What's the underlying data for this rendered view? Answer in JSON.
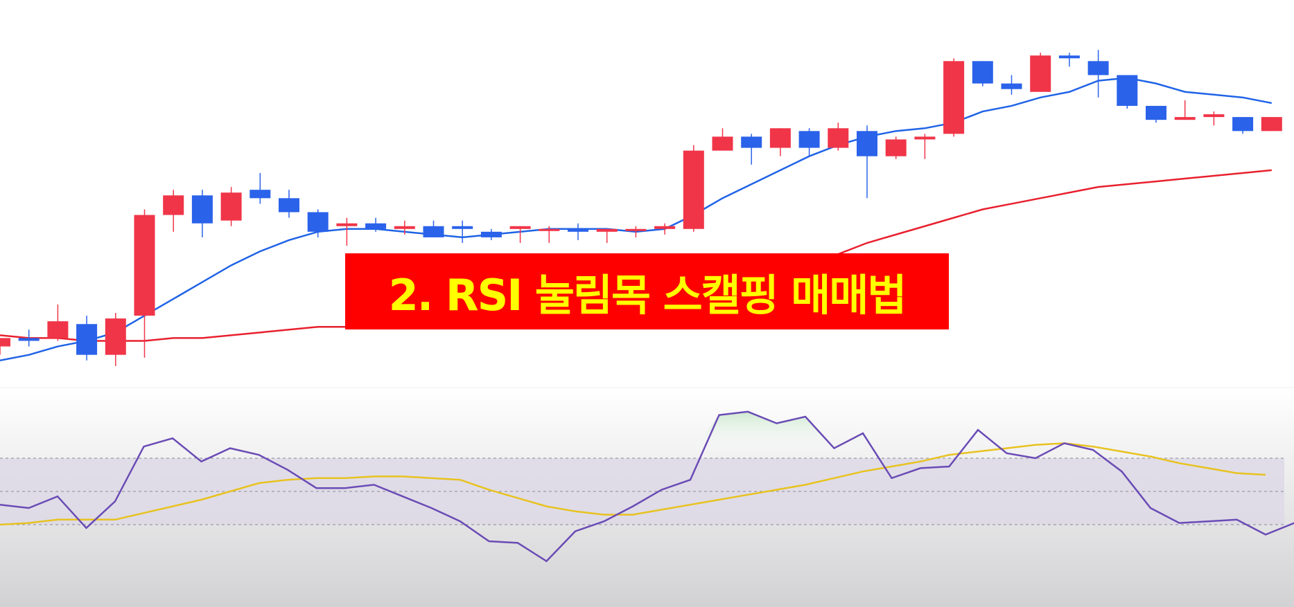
{
  "banner": {
    "title": "2. RSI 눌림목 스캘핑 매매법",
    "background": "#ff0000",
    "text_color": "#ffff00"
  },
  "colors": {
    "up_candle": "#f03548",
    "down_candle": "#2a62ea",
    "ma_short": "#1f63e6",
    "ma_long": "#e8202e",
    "rsi_line": "#6a4bb5",
    "rsi_signal": "#e8c21f",
    "rsi_band": "#ddd9e6",
    "rsi_overbought_fill": "#cfe9d0"
  },
  "chart_data": [
    {
      "type": "candlestick",
      "panel": "price",
      "y_domain": [
        0,
        100
      ],
      "candles": [
        {
          "x": 0,
          "o": 11.0,
          "h": 12.0,
          "l": 8.0,
          "c": 14.0
        },
        {
          "x": 1,
          "o": 14.0,
          "h": 17.0,
          "l": 11.0,
          "c": 13.0
        },
        {
          "x": 2,
          "o": 14.0,
          "h": 26.0,
          "l": 13.0,
          "c": 20.0
        },
        {
          "x": 3,
          "o": 19.0,
          "h": 22.0,
          "l": 6.0,
          "c": 8.0
        },
        {
          "x": 4,
          "o": 8.0,
          "h": 23.0,
          "l": 4.0,
          "c": 21.0
        },
        {
          "x": 5,
          "o": 22.0,
          "h": 60.0,
          "l": 7.0,
          "c": 58.0
        },
        {
          "x": 6,
          "o": 58.0,
          "h": 67.0,
          "l": 52.0,
          "c": 65.0
        },
        {
          "x": 7,
          "o": 65.0,
          "h": 67.0,
          "l": 50.0,
          "c": 55.0
        },
        {
          "x": 8,
          "o": 56.0,
          "h": 68.0,
          "l": 54.0,
          "c": 66.0
        },
        {
          "x": 9,
          "o": 67.0,
          "h": 73.0,
          "l": 62.0,
          "c": 64.0
        },
        {
          "x": 10,
          "o": 64.0,
          "h": 67.0,
          "l": 57.0,
          "c": 59.0
        },
        {
          "x": 11,
          "o": 59.0,
          "h": 60.0,
          "l": 50.0,
          "c": 52.0
        },
        {
          "x": 12,
          "o": 54.0,
          "h": 57.0,
          "l": 47.0,
          "c": 55.0
        },
        {
          "x": 13,
          "o": 55.0,
          "h": 57.0,
          "l": 52.0,
          "c": 53.0
        },
        {
          "x": 14,
          "o": 53.0,
          "h": 56.0,
          "l": 51.0,
          "c": 54.0
        },
        {
          "x": 15,
          "o": 54.0,
          "h": 56.0,
          "l": 50.0,
          "c": 50.0
        },
        {
          "x": 16,
          "o": 54.0,
          "h": 56.0,
          "l": 48.0,
          "c": 53.0
        },
        {
          "x": 17,
          "o": 52.0,
          "h": 53.0,
          "l": 49.0,
          "c": 50.0
        },
        {
          "x": 18,
          "o": 53.0,
          "h": 54.0,
          "l": 48.0,
          "c": 54.0
        },
        {
          "x": 19,
          "o": 53.0,
          "h": 54.0,
          "l": 48.0,
          "c": 53.0
        },
        {
          "x": 20,
          "o": 53.0,
          "h": 55.0,
          "l": 49.0,
          "c": 52.0
        },
        {
          "x": 21,
          "o": 52.0,
          "h": 53.0,
          "l": 48.0,
          "c": 53.0
        },
        {
          "x": 22,
          "o": 53.0,
          "h": 54.0,
          "l": 50.0,
          "c": 53.0
        },
        {
          "x": 23,
          "o": 53.0,
          "h": 55.0,
          "l": 51.0,
          "c": 54.0
        },
        {
          "x": 24,
          "o": 53.0,
          "h": 83.0,
          "l": 52.0,
          "c": 81.0
        },
        {
          "x": 25,
          "o": 81.0,
          "h": 89.0,
          "l": 81.0,
          "c": 86.0
        },
        {
          "x": 26,
          "o": 86.0,
          "h": 87.0,
          "l": 76.0,
          "c": 82.0
        },
        {
          "x": 27,
          "o": 82.0,
          "h": 89.0,
          "l": 79.0,
          "c": 89.0
        },
        {
          "x": 28,
          "o": 88.0,
          "h": 89.0,
          "l": 79.0,
          "c": 82.0
        },
        {
          "x": 29,
          "o": 82.0,
          "h": 91.0,
          "l": 81.0,
          "c": 89.0
        },
        {
          "x": 30,
          "o": 88.0,
          "h": 90.0,
          "l": 64.0,
          "c": 79.0
        },
        {
          "x": 31,
          "o": 79.0,
          "h": 86.0,
          "l": 78.0,
          "c": 85.0
        },
        {
          "x": 32,
          "o": 85.0,
          "h": 87.0,
          "l": 78.0,
          "c": 86.0
        },
        {
          "x": 33,
          "o": 87.0,
          "h": 114.0,
          "l": 86.0,
          "c": 113.0
        },
        {
          "x": 34,
          "o": 113.0,
          "h": 113.0,
          "l": 104.0,
          "c": 105.0
        },
        {
          "x": 35,
          "o": 105.0,
          "h": 108.0,
          "l": 101.0,
          "c": 103.0
        },
        {
          "x": 36,
          "o": 102.0,
          "h": 116.0,
          "l": 102.0,
          "c": 115.0
        },
        {
          "x": 37,
          "o": 115.0,
          "h": 116.0,
          "l": 111.0,
          "c": 114.0
        },
        {
          "x": 38,
          "o": 113.0,
          "h": 117.0,
          "l": 100.0,
          "c": 108.0
        },
        {
          "x": 39,
          "o": 108.0,
          "h": 108.0,
          "l": 96.0,
          "c": 97.0
        },
        {
          "x": 40,
          "o": 97.0,
          "h": 97.0,
          "l": 91.0,
          "c": 92.0
        },
        {
          "x": 41,
          "o": 92.0,
          "h": 99.0,
          "l": 92.0,
          "c": 93.0
        },
        {
          "x": 42,
          "o": 93.0,
          "h": 95.0,
          "l": 90.0,
          "c": 94.0
        },
        {
          "x": 43,
          "o": 93.0,
          "h": 93.0,
          "l": 87.0,
          "c": 88.0
        },
        {
          "x": 44,
          "o": 88.0,
          "h": 93.0,
          "l": 88.0,
          "c": 93.0
        }
      ],
      "ma_short": [
        6,
        8,
        11,
        13,
        16,
        22,
        28,
        34,
        40,
        45,
        49,
        52,
        53,
        53,
        52,
        51,
        50,
        51,
        52,
        53,
        53,
        53,
        52,
        53,
        58,
        64,
        69,
        74,
        79,
        83,
        86,
        88,
        89,
        91,
        95,
        97,
        100,
        102,
        106,
        107,
        105,
        102,
        101,
        100,
        98
      ],
      "ma_long": [
        15,
        14,
        14,
        13,
        13,
        13,
        14,
        14,
        15,
        16,
        17,
        18,
        18,
        18,
        19,
        19,
        20,
        20,
        21,
        22,
        23,
        24,
        25,
        26,
        28,
        31,
        34,
        37,
        41,
        44,
        48,
        51,
        54,
        57,
        60,
        62,
        64,
        66,
        68,
        69,
        70,
        71,
        72,
        73,
        74
      ]
    },
    {
      "type": "line",
      "panel": "rsi",
      "y_domain": [
        0,
        100
      ],
      "bands": [
        30,
        50,
        70
      ],
      "series": [
        {
          "key": "rsi",
          "values": [
            42,
            40,
            47,
            28,
            44,
            77,
            82,
            68,
            76,
            72,
            63,
            52,
            52,
            54,
            47,
            40,
            32,
            20,
            19,
            8,
            26,
            32,
            41,
            51,
            57,
            96,
            98,
            91,
            95,
            76,
            85,
            58,
            64,
            65,
            87,
            73,
            70,
            79,
            75,
            62,
            40,
            31,
            32,
            33,
            24,
            31
          ]
        },
        {
          "key": "signal",
          "values": [
            30,
            31,
            33,
            33,
            33,
            37,
            41,
            45,
            50,
            55,
            57,
            58,
            58,
            59,
            59,
            58,
            57,
            51,
            46,
            41,
            38,
            36,
            36,
            39,
            42,
            45,
            48,
            51,
            54,
            58,
            62,
            65,
            68,
            72,
            74,
            76,
            78,
            79,
            77,
            74,
            71,
            67,
            64,
            61,
            60
          ]
        }
      ]
    }
  ]
}
